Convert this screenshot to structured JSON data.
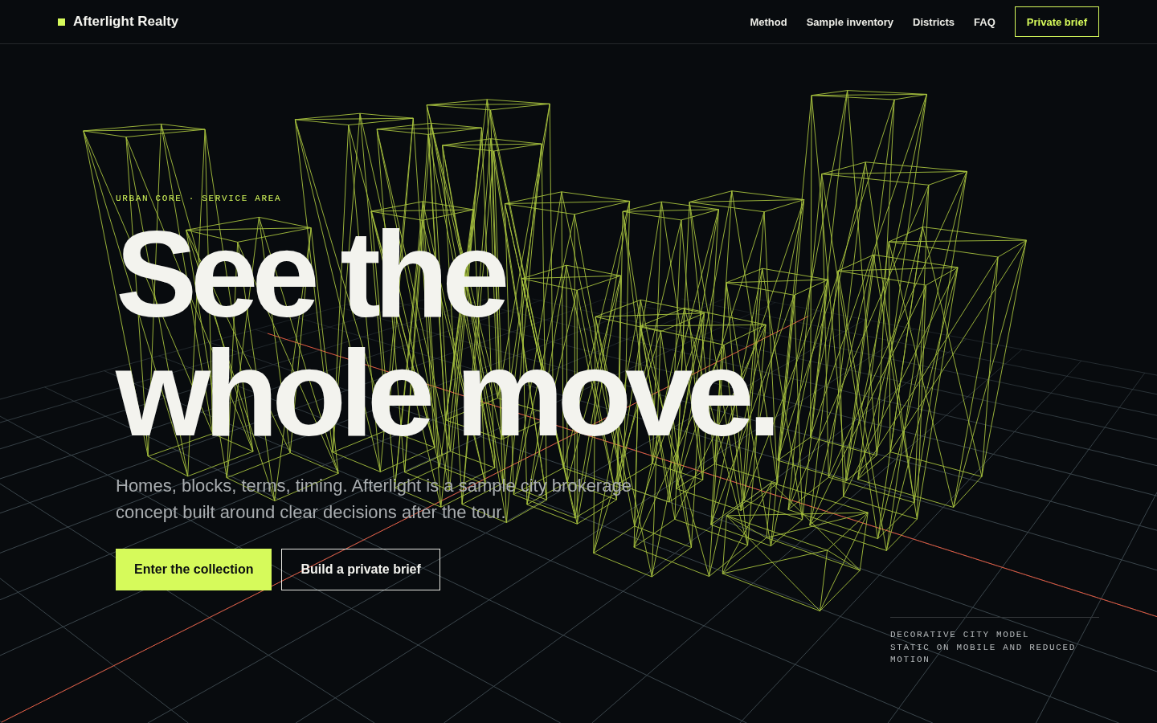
{
  "header": {
    "brand": "Afterlight Realty",
    "nav": [
      {
        "label": "Method"
      },
      {
        "label": "Sample inventory"
      },
      {
        "label": "Districts"
      },
      {
        "label": "FAQ"
      }
    ],
    "cta": {
      "label": "Private brief"
    }
  },
  "hero": {
    "eyebrow": "URBAN CORE · SERVICE AREA",
    "heading_lines": [
      "See the",
      "whole move."
    ],
    "lead": "Homes, blocks, terms, timing. Afterlight is a sample city brokerage concept built around clear decisions after the tour.",
    "actions": [
      {
        "label": "Enter the collection",
        "kind": "primary"
      },
      {
        "label": "Build a private brief",
        "kind": "secondary"
      }
    ]
  },
  "scene_caption": [
    "DECORATIVE CITY MODEL",
    "STATIC ON MOBILE AND REDUCED MOTION"
  ]
}
